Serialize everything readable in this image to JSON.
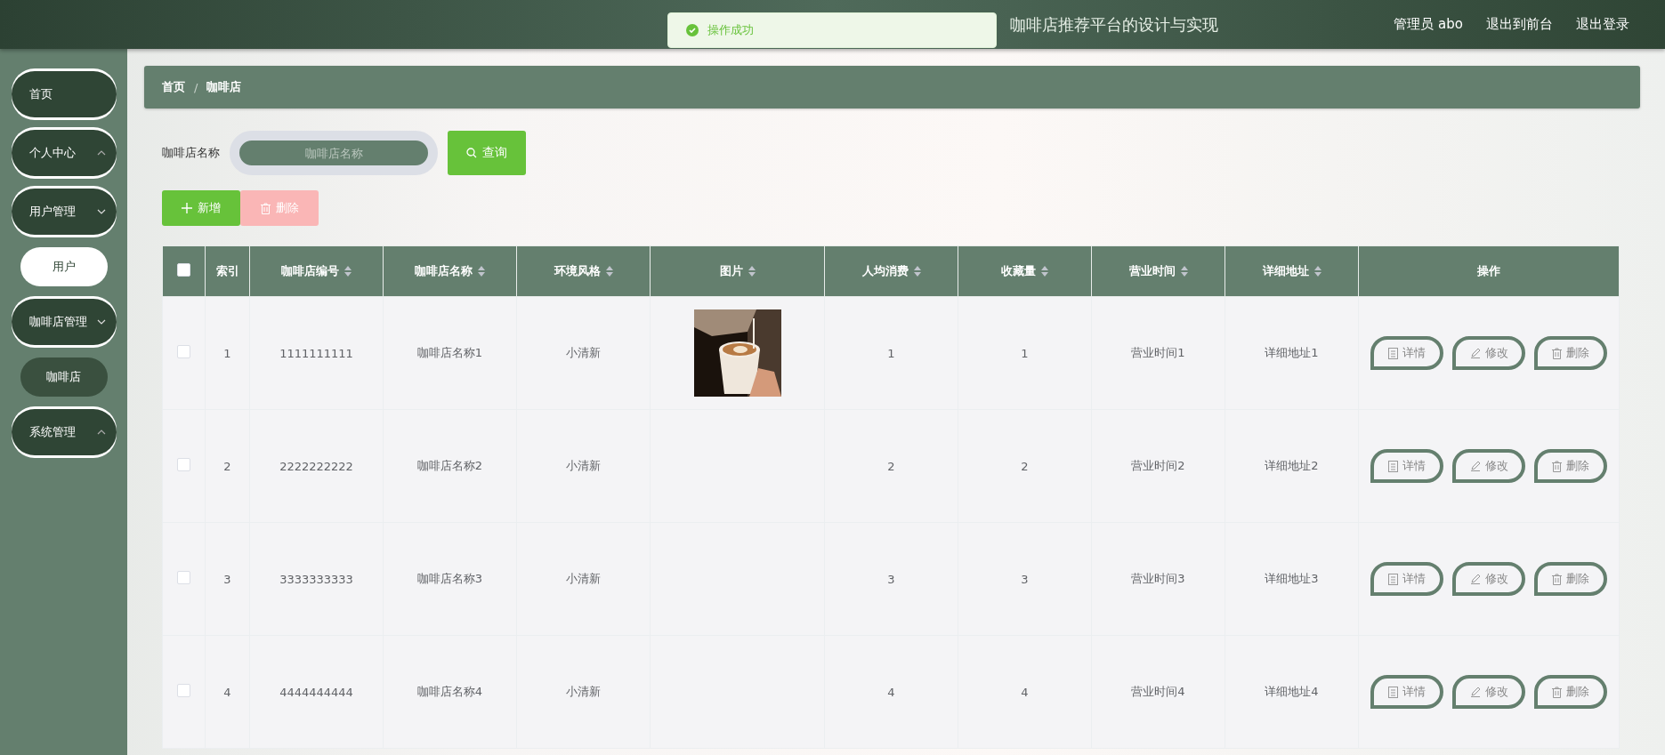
{
  "header": {
    "title": "咖啡店推荐平台的设计与实现",
    "links": [
      "管理员 abo",
      "退出到前台",
      "退出登录"
    ]
  },
  "toast": {
    "kind": "success",
    "message": "操作成功"
  },
  "sidebar": {
    "items": [
      {
        "label": "首页",
        "kind": "link"
      },
      {
        "label": "个人中心",
        "kind": "group",
        "expanded": false
      },
      {
        "label": "用户管理",
        "kind": "group",
        "expanded": true,
        "children": [
          {
            "label": "用户",
            "selected": true
          }
        ]
      },
      {
        "label": "咖啡店管理",
        "kind": "group",
        "expanded": true,
        "children": [
          {
            "label": "咖啡店",
            "selected": false
          }
        ]
      },
      {
        "label": "系统管理",
        "kind": "group",
        "expanded": false
      }
    ]
  },
  "breadcrumb": {
    "items": [
      "首页",
      "咖啡店"
    ],
    "separator": "/"
  },
  "search": {
    "label": "咖啡店名称",
    "placeholder": "咖啡店名称",
    "button": "查询"
  },
  "toolbar": [
    {
      "label": "新增",
      "kind": "add",
      "disabled": false
    },
    {
      "label": "删除",
      "kind": "delete",
      "disabled": true
    }
  ],
  "table": {
    "all_checked": false,
    "columns": [
      {
        "label": "索引",
        "sortable": false
      },
      {
        "label": "咖啡店编号",
        "sortable": true
      },
      {
        "label": "咖啡店名称",
        "sortable": true
      },
      {
        "label": "环境风格",
        "sortable": true
      },
      {
        "label": "图片",
        "sortable": true
      },
      {
        "label": "人均消费",
        "sortable": true
      },
      {
        "label": "收藏量",
        "sortable": true
      },
      {
        "label": "营业时间",
        "sortable": true
      },
      {
        "label": "详细地址",
        "sortable": true
      },
      {
        "label": "操作",
        "sortable": false
      }
    ],
    "rows": [
      {
        "checked": false,
        "cells": [
          "1",
          "1111111111",
          "咖啡店名称1",
          "小清新",
          {
            "kind": "picture"
          },
          "1",
          "1",
          "营业时间1",
          "详细地址1"
        ],
        "actions": [
          {
            "label": "详情",
            "kind": "detail"
          },
          {
            "label": "修改",
            "kind": "edit"
          },
          {
            "label": "删除",
            "kind": "delete"
          }
        ]
      },
      {
        "checked": false,
        "cells": [
          "2",
          "2222222222",
          "咖啡店名称2",
          "小清新",
          {
            "kind": "empty"
          },
          "2",
          "2",
          "营业时间2",
          "详细地址2"
        ],
        "actions": [
          {
            "label": "详情",
            "kind": "detail"
          },
          {
            "label": "修改",
            "kind": "edit"
          },
          {
            "label": "删除",
            "kind": "delete"
          }
        ]
      },
      {
        "checked": false,
        "cells": [
          "3",
          "3333333333",
          "咖啡店名称3",
          "小清新",
          {
            "kind": "empty"
          },
          "3",
          "3",
          "营业时间3",
          "详细地址3"
        ],
        "actions": [
          {
            "label": "详情",
            "kind": "detail"
          },
          {
            "label": "修改",
            "kind": "edit"
          },
          {
            "label": "删除",
            "kind": "delete"
          }
        ]
      },
      {
        "checked": false,
        "cells": [
          "4",
          "4444444444",
          "咖啡店名称4",
          "小清新",
          {
            "kind": "empty"
          },
          "4",
          "4",
          "营业时间4",
          "详细地址4"
        ],
        "actions": [
          {
            "label": "详情",
            "kind": "detail"
          },
          {
            "label": "修改",
            "kind": "edit"
          },
          {
            "label": "删除",
            "kind": "delete"
          }
        ]
      }
    ]
  }
}
